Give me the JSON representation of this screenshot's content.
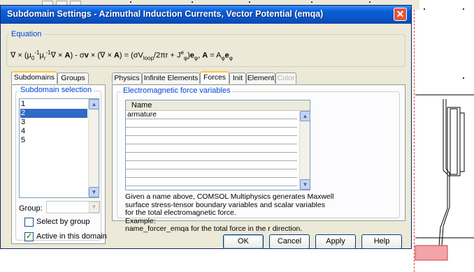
{
  "window": {
    "title": "Subdomain Settings - Azimuthal Induction Currents, Vector Potential (emqa)",
    "close_glyph": "✕"
  },
  "equation": {
    "legend": "Equation",
    "text": "∇ × (μ₀⁻¹μᵣ⁻¹∇ × A) - σv × (∇ × A) = (σV_loop/2πr + J^e_φ)e_φ, A = A_φe_φ"
  },
  "left_tabs": [
    {
      "label": "Subdomains",
      "active": true
    },
    {
      "label": "Groups",
      "active": false
    }
  ],
  "subdomain_selection": {
    "legend": "Subdomain selection",
    "items": [
      "1",
      "2",
      "3",
      "4",
      "5"
    ],
    "selected_index": 1
  },
  "group": {
    "label": "Group:",
    "value": ""
  },
  "checkboxes": {
    "select_by_group": {
      "label": "Select by group",
      "checked": false
    },
    "active_in_domain": {
      "label": "Active in this domain",
      "checked": true
    }
  },
  "right_tabs": [
    {
      "label": "Physics",
      "active": false,
      "disabled": false
    },
    {
      "label": "Infinite Elements",
      "active": false,
      "disabled": false
    },
    {
      "label": "Forces",
      "active": true,
      "disabled": false
    },
    {
      "label": "Init",
      "active": false,
      "disabled": false
    },
    {
      "label": "Element",
      "active": false,
      "disabled": false
    },
    {
      "label": "Color",
      "active": false,
      "disabled": true
    }
  ],
  "forces": {
    "legend": "Electromagnetic force variables",
    "column_header": "Name",
    "rows": [
      "armature",
      "",
      "",
      "",
      "",
      "",
      "",
      "",
      ""
    ],
    "description_lines": [
      "Given a name above, COMSOL Multiphysics generates Maxwell",
      "surface stress-tensor boundary variables and scalar variables",
      "for the total electromagnetic force.",
      "Example:",
      "name_forcer_emqa for the total force in the r direction."
    ]
  },
  "buttons": {
    "ok": "OK",
    "cancel": "Cancel",
    "apply": "Apply",
    "help": "Help"
  },
  "colors": {
    "titlebar": "#0a55c8",
    "selection": "#316ac5",
    "legend_text": "#0046d5",
    "highlight_block": "#f2a4a8"
  }
}
